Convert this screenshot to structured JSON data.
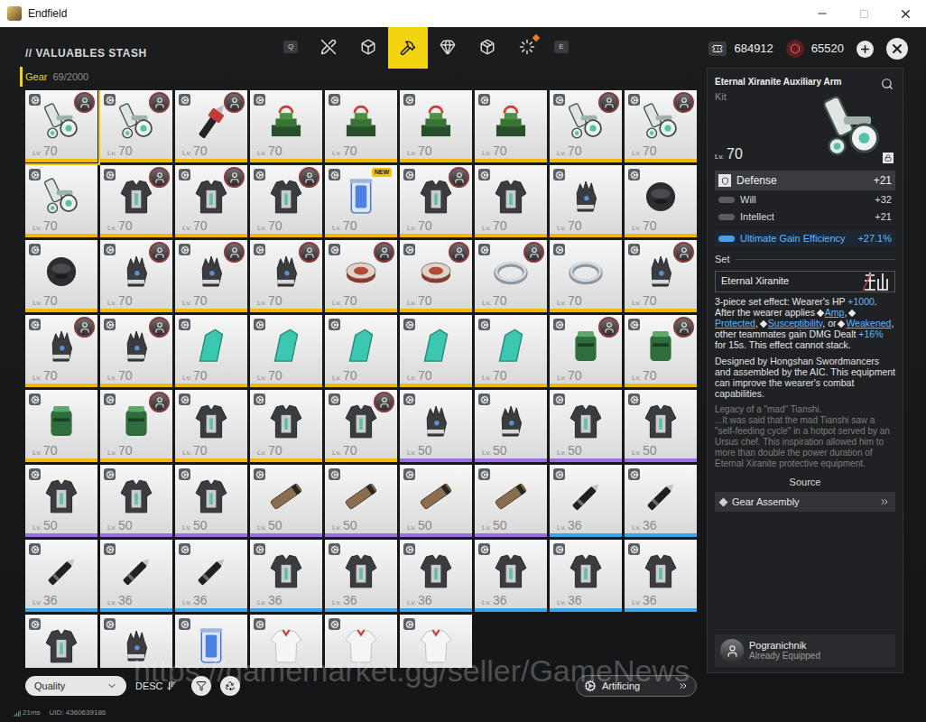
{
  "window": {
    "title": "Endfield"
  },
  "header": {
    "title": "// VALUABLES STASH",
    "prev_key": "Q",
    "next_key": "E",
    "tabs": [
      {
        "kind": "tools",
        "selected": false,
        "dot": false
      },
      {
        "kind": "block",
        "selected": false,
        "dot": false
      },
      {
        "kind": "gear",
        "selected": true,
        "dot": false
      },
      {
        "kind": "mineral",
        "selected": false,
        "dot": false
      },
      {
        "kind": "building",
        "selected": false,
        "dot": false
      },
      {
        "kind": "misc",
        "selected": false,
        "dot": true
      }
    ],
    "currencies": [
      {
        "kind": "ticket",
        "amount": "684912"
      },
      {
        "kind": "crystal",
        "amount": "65520"
      }
    ]
  },
  "category": {
    "label": "Gear",
    "count": "69/2000"
  },
  "level_prefix": "Lv.",
  "items": [
    {
      "kind": "arm",
      "level": "70",
      "equipped": true,
      "selected": true,
      "color": "#f5b800"
    },
    {
      "kind": "arm",
      "level": "70",
      "equipped": true,
      "selected": false,
      "color": "#f5b800"
    },
    {
      "kind": "drill",
      "level": "70",
      "equipped": true,
      "selected": false,
      "color": "#f5b800"
    },
    {
      "kind": "cube",
      "level": "70",
      "equipped": false,
      "selected": false,
      "color": "#f5b800"
    },
    {
      "kind": "cube",
      "level": "70",
      "equipped": false,
      "selected": false,
      "color": "#f5b800"
    },
    {
      "kind": "cube",
      "level": "70",
      "equipped": false,
      "selected": false,
      "color": "#f5b800"
    },
    {
      "kind": "cube",
      "level": "70",
      "equipped": false,
      "selected": false,
      "color": "#f5b800"
    },
    {
      "kind": "arm",
      "level": "70",
      "equipped": true,
      "selected": false,
      "color": "#f5b800"
    },
    {
      "kind": "arm",
      "level": "70",
      "equipped": true,
      "selected": false,
      "color": "#f5b800"
    },
    {
      "kind": "arm",
      "level": "70",
      "equipped": false,
      "selected": false,
      "color": "#f5b800"
    },
    {
      "kind": "armor",
      "level": "70",
      "equipped": true,
      "selected": false,
      "color": "#f5b800"
    },
    {
      "kind": "armor",
      "level": "70",
      "equipped": true,
      "selected": false,
      "color": "#f5b800"
    },
    {
      "kind": "armor",
      "level": "70",
      "equipped": true,
      "selected": false,
      "color": "#f5b800"
    },
    {
      "kind": "canister",
      "level": "70",
      "equipped": false,
      "selected": false,
      "color": "#f5b800",
      "badge": "NEW"
    },
    {
      "kind": "armor",
      "level": "70",
      "equipped": true,
      "selected": false,
      "color": "#f5b800"
    },
    {
      "kind": "armor",
      "level": "70",
      "equipped": false,
      "selected": false,
      "color": "#f5b800"
    },
    {
      "kind": "gloves",
      "level": "70",
      "equipped": false,
      "selected": false,
      "color": "#f5b800"
    },
    {
      "kind": "mask",
      "level": "70",
      "equipped": false,
      "selected": false,
      "color": "#f5b800"
    },
    {
      "kind": "mask",
      "level": "70",
      "equipped": false,
      "selected": false,
      "color": "#f5b800"
    },
    {
      "kind": "gloves",
      "level": "70",
      "equipped": true,
      "selected": false,
      "color": "#f5b800"
    },
    {
      "kind": "gloves",
      "level": "70",
      "equipped": true,
      "selected": false,
      "color": "#f5b800"
    },
    {
      "kind": "gloves",
      "level": "70",
      "equipped": true,
      "selected": false,
      "color": "#f5b800"
    },
    {
      "kind": "ring",
      "level": "70",
      "equipped": true,
      "selected": false,
      "color": "#f5b800"
    },
    {
      "kind": "ring",
      "level": "70",
      "equipped": true,
      "selected": false,
      "color": "#f5b800"
    },
    {
      "kind": "band",
      "level": "70",
      "equipped": true,
      "selected": false,
      "color": "#f5b800"
    },
    {
      "kind": "band",
      "level": "70",
      "equipped": false,
      "selected": false,
      "color": "#f5b800"
    },
    {
      "kind": "gloves",
      "level": "70",
      "equipped": true,
      "selected": false,
      "color": "#f5b800"
    },
    {
      "kind": "gloves",
      "level": "70",
      "equipped": true,
      "selected": false,
      "color": "#f5b800"
    },
    {
      "kind": "gloves",
      "level": "70",
      "equipped": true,
      "selected": false,
      "color": "#f5b800"
    },
    {
      "kind": "crystal",
      "level": "70",
      "equipped": false,
      "selected": false,
      "color": "#f5b800"
    },
    {
      "kind": "crystal",
      "level": "70",
      "equipped": false,
      "selected": false,
      "color": "#f5b800"
    },
    {
      "kind": "crystal",
      "level": "70",
      "equipped": false,
      "selected": false,
      "color": "#f5b800"
    },
    {
      "kind": "crystal",
      "level": "70",
      "equipped": false,
      "selected": false,
      "color": "#f5b800"
    },
    {
      "kind": "crystal",
      "level": "70",
      "equipped": false,
      "selected": false,
      "color": "#f5b800"
    },
    {
      "kind": "jar",
      "level": "70",
      "equipped": true,
      "selected": false,
      "color": "#f5b800"
    },
    {
      "kind": "jar",
      "level": "70",
      "equipped": true,
      "selected": false,
      "color": "#f5b800"
    },
    {
      "kind": "jar",
      "level": "70",
      "equipped": false,
      "selected": false,
      "color": "#f5b800"
    },
    {
      "kind": "jar",
      "level": "70",
      "equipped": true,
      "selected": false,
      "color": "#f5b800"
    },
    {
      "kind": "armor",
      "level": "70",
      "equipped": false,
      "selected": false,
      "color": "#f5b800"
    },
    {
      "kind": "armor",
      "level": "70",
      "equipped": false,
      "selected": false,
      "color": "#f5b800"
    },
    {
      "kind": "armor",
      "level": "70",
      "equipped": true,
      "selected": false,
      "color": "#f5b800"
    },
    {
      "kind": "gloves",
      "level": "50",
      "equipped": false,
      "selected": false,
      "color": "#9d6ee0"
    },
    {
      "kind": "gloves",
      "level": "50",
      "equipped": false,
      "selected": false,
      "color": "#9d6ee0"
    },
    {
      "kind": "armor",
      "level": "50",
      "equipped": false,
      "selected": false,
      "color": "#9d6ee0"
    },
    {
      "kind": "armor",
      "level": "50",
      "equipped": false,
      "selected": false,
      "color": "#9d6ee0"
    },
    {
      "kind": "armor",
      "level": "50",
      "equipped": false,
      "selected": false,
      "color": "#9d6ee0"
    },
    {
      "kind": "armor",
      "level": "50",
      "equipped": false,
      "selected": false,
      "color": "#9d6ee0"
    },
    {
      "kind": "armor",
      "level": "50",
      "equipped": false,
      "selected": false,
      "color": "#9d6ee0"
    },
    {
      "kind": "tube",
      "level": "50",
      "equipped": false,
      "selected": false,
      "color": "#9d6ee0"
    },
    {
      "kind": "tube",
      "level": "50",
      "equipped": false,
      "selected": false,
      "color": "#9d6ee0"
    },
    {
      "kind": "tube",
      "level": "50",
      "equipped": false,
      "selected": false,
      "color": "#9d6ee0"
    },
    {
      "kind": "tube",
      "level": "50",
      "equipped": false,
      "selected": false,
      "color": "#9d6ee0"
    },
    {
      "kind": "pen",
      "level": "36",
      "equipped": false,
      "selected": false,
      "color": "#3ba4e6"
    },
    {
      "kind": "pen",
      "level": "36",
      "equipped": false,
      "selected": false,
      "color": "#3ba4e6"
    },
    {
      "kind": "pen",
      "level": "36",
      "equipped": false,
      "selected": false,
      "color": "#3ba4e6"
    },
    {
      "kind": "pen",
      "level": "36",
      "equipped": false,
      "selected": false,
      "color": "#3ba4e6"
    },
    {
      "kind": "pen",
      "level": "36",
      "equipped": false,
      "selected": false,
      "color": "#3ba4e6"
    },
    {
      "kind": "armor",
      "level": "36",
      "equipped": false,
      "selected": false,
      "color": "#3ba4e6"
    },
    {
      "kind": "armor",
      "level": "36",
      "equipped": false,
      "selected": false,
      "color": "#3ba4e6"
    },
    {
      "kind": "armor",
      "level": "36",
      "equipped": false,
      "selected": false,
      "color": "#3ba4e6"
    },
    {
      "kind": "armor",
      "level": "36",
      "equipped": false,
      "selected": false,
      "color": "#3ba4e6"
    },
    {
      "kind": "armor",
      "level": "36",
      "equipped": false,
      "selected": false,
      "color": "#3ba4e6"
    },
    {
      "kind": "armor",
      "level": "36",
      "equipped": false,
      "selected": false,
      "color": "#3ba4e6"
    },
    {
      "kind": "armor",
      "equipped": false,
      "selected": false
    },
    {
      "kind": "gloves",
      "equipped": false,
      "selected": false
    },
    {
      "kind": "canister",
      "equipped": false,
      "selected": false
    },
    {
      "kind": "shirt",
      "equipped": false,
      "selected": false
    },
    {
      "kind": "shirt",
      "equipped": false,
      "selected": false
    },
    {
      "kind": "shirt",
      "equipped": false,
      "selected": false
    }
  ],
  "detail": {
    "name": "Eternal Xiranite Auxiliary Arm",
    "type": "Kit",
    "level": "70",
    "stats": [
      {
        "name": "Defense",
        "value": "+21",
        "kind": "primary"
      },
      {
        "name": "Will",
        "value": "+32",
        "kind": "secondary"
      },
      {
        "name": "Intellect",
        "value": "+21",
        "kind": "secondary"
      },
      {
        "name": "Ultimate Gain Efficiency",
        "value": "+27.1%",
        "kind": "special"
      }
    ],
    "set_label": "Set",
    "set_name": "Eternal Xiranite",
    "set_effect": [
      {
        "text": "3-piece set effect: Wearer's HP ",
        "kind": "plain"
      },
      {
        "text": "+1000",
        "kind": "value"
      },
      {
        "text": ". After the wearer applies ",
        "kind": "plain"
      },
      {
        "text": "Amp",
        "kind": "link"
      },
      {
        "text": ", ",
        "kind": "plain"
      },
      {
        "text": "Protected",
        "kind": "link"
      },
      {
        "text": ", ",
        "kind": "plain"
      },
      {
        "text": "Susceptibility",
        "kind": "link"
      },
      {
        "text": ", or ",
        "kind": "plain"
      },
      {
        "text": "Weakened",
        "kind": "link"
      },
      {
        "text": ", other teammates gain DMG Dealt ",
        "kind": "plain"
      },
      {
        "text": "+16%",
        "kind": "value"
      },
      {
        "text": " for 15s. This effect cannot stack.",
        "kind": "plain"
      }
    ],
    "description": "Designed by Hongshan Swordmancers and assembled by the AIC. This equipment can improve the wearer's combat capabilities.",
    "lore_title": "Legacy of a \"mad\" Tianshi.",
    "lore": "...It was said that the mad Tianshi saw a \"self-feeding cycle\" in a hotpot served by an Ursus chef. This inspiration allowed him to more than double the power duration of Eternal Xiranite protective equipment.",
    "source_title": "Source",
    "source": "Gear Assembly",
    "equipped_by": {
      "name": "Pogranichnik",
      "status": "Already Equipped"
    }
  },
  "toolbar": {
    "sort_label": "Quality",
    "order": "DESC",
    "artificing": "Artificing"
  },
  "status": {
    "latency": "21ms",
    "uid": "UID: 4360639186"
  },
  "watermark": "https://gamemarket.gg/seller/GameNews"
}
